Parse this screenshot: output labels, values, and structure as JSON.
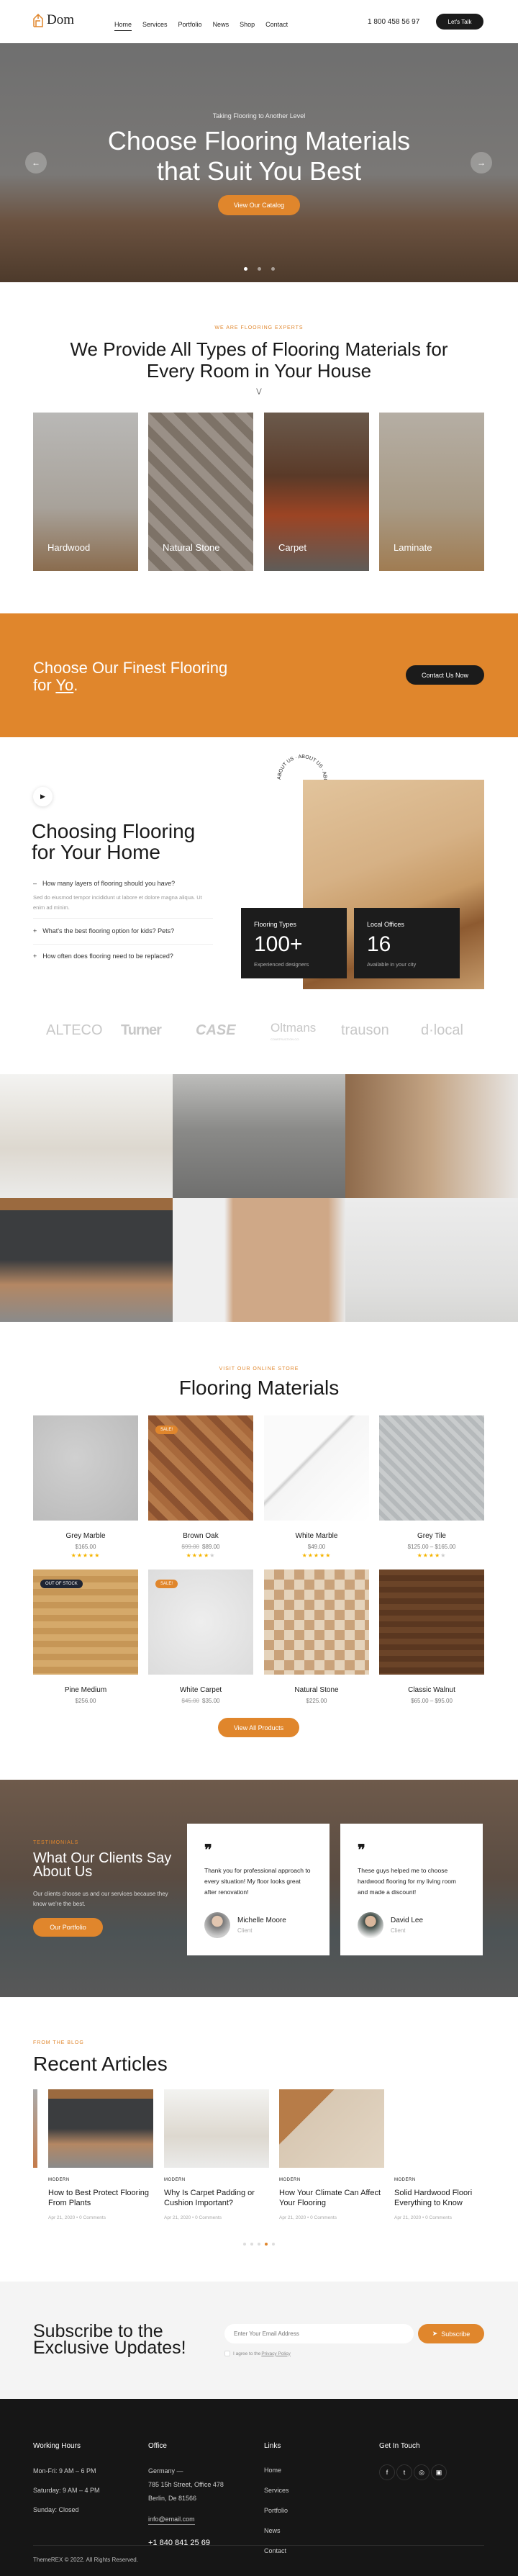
{
  "brand": {
    "name": "Dom",
    "accent": "#e0862c",
    "dark": "#1b1b1b"
  },
  "header": {
    "nav": [
      "Home",
      "Services",
      "Portfolio",
      "News",
      "Shop",
      "Contact"
    ],
    "active": "Home",
    "phone": "1 800 458 56 97",
    "cta": "Let's Talk"
  },
  "hero": {
    "subtitle": "Taking Flooring to Another Level",
    "title_line1": "Choose Flooring Materials",
    "title_line2": "that Suit You Best",
    "button": "View Our Catalog",
    "slides": 3,
    "active_slide": 1
  },
  "types": {
    "label": "We are flooring experts",
    "title_line1": "We Provide All Types of Flooring Materials for",
    "title_line2": "Every Room in Your House",
    "cards": [
      "Hardwood",
      "Natural Stone",
      "Carpet",
      "Laminate"
    ]
  },
  "cta_band": {
    "title_line1": "Choose Our Finest Flooring",
    "title_for": "for ",
    "title_word": "Yo",
    "title_end": ".",
    "button": "Contact Us Now"
  },
  "about": {
    "circle_text": "ABOUT US · ABOUT US · ABOUT US ·",
    "title_line1": "Choosing Flooring",
    "title_line2": "for Your Home",
    "faq": [
      {
        "q": "How many layers of flooring should you have?",
        "a": "Sed do eiusmod tempor incididunt ut labore et dolore magna aliqua. Ut enim ad minim.",
        "open": true
      },
      {
        "q": "What's the best flooring option for kids? Pets?",
        "open": false
      },
      {
        "q": "How often does flooring need to be replaced?",
        "open": false
      }
    ],
    "stats": [
      {
        "label": "Flooring Types",
        "value": "100+",
        "caption": "Experienced designers"
      },
      {
        "label": "Local Offices",
        "value": "16",
        "caption": "Available in your city"
      }
    ]
  },
  "partners": [
    "ALTECO",
    "Turner",
    "CASE",
    "Oltmans",
    "trauson",
    "d·local"
  ],
  "partner_sub": "CONSTRUCTION CO.",
  "products": {
    "label": "Visit our online store",
    "title": "Flooring Materials",
    "button": "View All Products",
    "items": [
      {
        "name": "Grey Marble",
        "price": "$165.00",
        "rating": 5
      },
      {
        "name": "Brown Oak",
        "old_price": "$99.00",
        "price": "$89.00",
        "rating": 4,
        "badge": "SALE!"
      },
      {
        "name": "White Marble",
        "price": "$49.00",
        "rating": 5
      },
      {
        "name": "Grey Tile",
        "price": "$125.00 – $165.00",
        "rating": 4
      },
      {
        "name": "Pine Medium",
        "price": "$256.00",
        "badge": "OUT OF STOCK"
      },
      {
        "name": "White Carpet",
        "old_price": "$45.00",
        "price": "$35.00",
        "badge": "SALE!"
      },
      {
        "name": "Natural Stone",
        "price": "$225.00"
      },
      {
        "name": "Classic Walnut",
        "price": "$65.00 – $95.00"
      }
    ]
  },
  "testimonials": {
    "label": "Testimonials",
    "title_line1": "What Our Clients Say",
    "title_line2": "About Us",
    "text": "Our clients choose us and our services because they know we're the best.",
    "button": "Our Portfolio",
    "items": [
      {
        "quote": "Thank you for professional approach to every situation! My floor looks great after renovation!",
        "name": "Michelle Moore",
        "role": "Client"
      },
      {
        "quote": "These guys helped me to choose hardwood flooring for my living room and made a discount!",
        "name": "David Lee",
        "role": "Client"
      }
    ]
  },
  "blog": {
    "label": "From the blog",
    "title": "Recent Articles",
    "posts": [
      {
        "tag": "MODERN",
        "title": "How to Best Protect Flooring From Plants",
        "date": "Apr 21, 2020",
        "comments": "0 Comments"
      },
      {
        "tag": "MODERN",
        "title": "Why Is Carpet Padding or Cushion Important?",
        "date": "Apr 21, 2020",
        "comments": "0 Comments"
      },
      {
        "tag": "MODERN",
        "title": "How Your Climate Can Affect Your Flooring",
        "date": "Apr 21, 2020",
        "comments": "0 Comments"
      },
      {
        "tag": "MODERN",
        "title": "Solid Hardwood Floori Everything to Know",
        "date": "Apr 21, 2020",
        "comments": "0 Comments"
      }
    ],
    "dots": 5,
    "active_dot": 4
  },
  "subscribe": {
    "title_line1": "Subscribe to the",
    "title_line2": "Exclusive Updates!",
    "placeholder": "Enter Your Email Address",
    "button": "Subscribe",
    "agree": "I agree to the ",
    "policy": "Privacy Policy"
  },
  "footer": {
    "hours_title": "Working Hours",
    "hours": [
      "Mon-Fri: 9 AM – 6 PM",
      "Saturday: 9 AM – 4 PM",
      "Sunday: Closed"
    ],
    "office_title": "Office",
    "office": [
      "Germany —",
      "785 15h Street, Office 478",
      "Berlin, De 81566"
    ],
    "email": "info@email.com",
    "phone": "+1 840 841 25 69",
    "links_title": "Links",
    "links": [
      "Home",
      "Services",
      "Portfolio",
      "News",
      "Contact"
    ],
    "touch_title": "Get In Touch",
    "social": [
      "facebook",
      "twitter",
      "dribbble",
      "instagram"
    ],
    "copyright": "ThemeREX © 2022. All Rights Reserved."
  }
}
